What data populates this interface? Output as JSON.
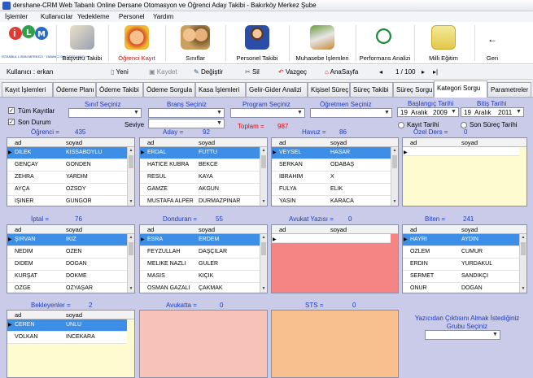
{
  "window": {
    "title": "dershane-CRM Web Tabanlı Online Dersane Otomasyon ve Öğrenci Aday Takibi  -  Bakırköy Merkez Şube"
  },
  "menu": [
    "İşlemler",
    "Kullanıcılar",
    "Yedekleme",
    "Personel",
    "Yardım"
  ],
  "toolbar": {
    "logo_text": "ISTANBUL LISAN MERKEZI · YABANCI DIL DERSANESI",
    "buttons": [
      "Başvuru  Takibi",
      "Öğrenci Kayıt",
      "Sınıflar",
      "Personel Takibi",
      "Muhasebe İşlemleri",
      "Performans Analizi",
      "Milli Eğitim",
      "Geri"
    ]
  },
  "nav": {
    "user_label": "Kullanıcı : erkan",
    "yeni": "Yeni",
    "kaydet": "Kaydet",
    "degistir": "Değiştir",
    "sil": "Sil",
    "vazgec": "Vazgeç",
    "anasayfa": "AnaSayfa",
    "page": "1 / 100"
  },
  "tabs": [
    "Kayıt İşlemleri",
    "Ödeme Planı",
    "Ödeme Takibi",
    "Ödeme Sorgula",
    "Kasa İşlemleri",
    "Gelir-Gider Analizi",
    "Kişisel Süreç",
    "Süreç Takibi",
    "Süreç Sorgu",
    "Kategori Sorgu",
    "Parametreler"
  ],
  "filters": {
    "tum_kayitlar": "Tüm Kayıtlar",
    "son_durum": "Son Durum",
    "sinif": "Sınıf Seçiniz",
    "brans": "Branş Seçiniz",
    "program": "Program Seçiniz",
    "ogretmen": "Öğretmen Seçiniz",
    "seviye": "Seviye",
    "toplam_label": "Toplam  =",
    "toplam_value": "987",
    "baslangic": "Başlangıç Tarihi",
    "bitis": "Bitiş Tarihi",
    "date1": [
      "19",
      "Aralık",
      "2009"
    ],
    "date2": [
      "19",
      "Aralık",
      "2011"
    ],
    "kayit_tarihi": "Kayıt Tarihi",
    "son_surec": "Son Süreç Tarihi"
  },
  "col_ad": "ad",
  "col_soyad": "soyad",
  "panels": {
    "ogrenci": {
      "label": "Öğrenci =",
      "count": "435",
      "rows": [
        [
          "DİLEK",
          "KISSABOYLU"
        ],
        [
          "GENÇAY",
          "GÖNDEN"
        ],
        [
          "ZEHRA",
          "YARDIM"
        ],
        [
          "AYÇA",
          "ÖZSOY"
        ],
        [
          "IŞINER",
          "GÜNGÖR"
        ]
      ]
    },
    "aday": {
      "label": "Aday =",
      "count": "92",
      "rows": [
        [
          "ERDAL",
          "FUTTU"
        ],
        [
          "HATİCE KÜBRA",
          "BEKCE"
        ],
        [
          "RESUL",
          "KAYA"
        ],
        [
          "GAMZE",
          "AKGÜN"
        ],
        [
          "MUSTAFA ALPER",
          "DURMAZPINAR"
        ]
      ]
    },
    "havuz": {
      "label": "Havuz =",
      "count": "86",
      "rows": [
        [
          "VEYSEL",
          "HASAR"
        ],
        [
          "SERKAN",
          "ODABAŞ"
        ],
        [
          "İBRAHİM",
          "X"
        ],
        [
          "FULYA",
          "ELİK"
        ],
        [
          "YASİN",
          "KARACA"
        ]
      ]
    },
    "ozel": {
      "label": "Özel Ders =",
      "count": "0",
      "rows": []
    },
    "iptal": {
      "label": "İptal =",
      "count": "76",
      "rows": [
        [
          "ŞIRVAN",
          "İKİZ"
        ],
        [
          "NEDİM",
          "ÖZEN"
        ],
        [
          "DİDEM",
          "DOĞAN"
        ],
        [
          "KÜRŞAT",
          "DÖKME"
        ],
        [
          "ÖZGE",
          "ÖZYAŞAR"
        ]
      ]
    },
    "donduran": {
      "label": "Donduran =",
      "count": "55",
      "rows": [
        [
          "ESRA",
          "ERDEM"
        ],
        [
          "FEYZULLAH",
          "DAŞÇILAR"
        ],
        [
          "MELİKE NAZLI",
          "GÜLER"
        ],
        [
          "MASIS",
          "KIÇIK"
        ],
        [
          "OSMAN GAZALİ",
          "ÇAKMAK"
        ]
      ]
    },
    "avukat_yazisi": {
      "label": "Avukat Yazısı =",
      "count": "0",
      "rows": []
    },
    "biten": {
      "label": "Biten =",
      "count": "241",
      "rows": [
        [
          "HAYRİ",
          "AYDIN"
        ],
        [
          "ÖZLEM",
          "CUMUR"
        ],
        [
          "ERDİN",
          "YURDAKUL"
        ],
        [
          "SERMET",
          "SANDIKÇI"
        ],
        [
          "ONUR",
          "DOĞAN"
        ]
      ]
    },
    "bekleyenler": {
      "label": "Bekleyenler =",
      "count": "2",
      "rows": [
        [
          "CEREN",
          "ÜNLÜ"
        ],
        [
          "VOLKAN",
          "İNCEKARA"
        ]
      ]
    },
    "avukatta": {
      "label": "Avukatta =",
      "count": "0"
    },
    "sts": {
      "label": "STS =",
      "count": "0"
    }
  },
  "print": {
    "label": "Yazıcıdan Çıktısını Almak İstediğiniz Grubu Seçiniz"
  },
  "colors": {
    "content_bg": "#c9cbe9",
    "selected_row": "#3d8ee6",
    "yellow_panel": "#fffbd0",
    "red_panel": "#f58585",
    "pink_panel": "#f7c2b8",
    "orange_panel": "#f8bf8f"
  }
}
